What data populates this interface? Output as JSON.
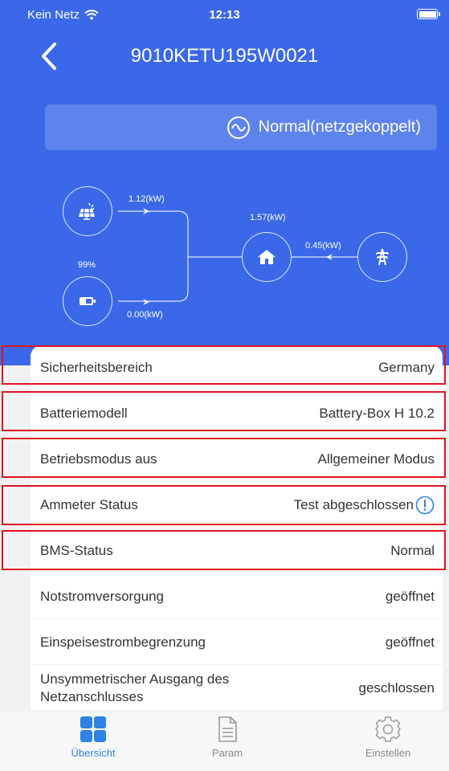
{
  "status_bar": {
    "carrier": "Kein Netz",
    "time": "12:13"
  },
  "header": {
    "title": "9010KETU195W0021",
    "mode_text": "Normal(netzgekoppelt)"
  },
  "flow": {
    "pv_power": "1.12(kW)",
    "battery_soc": "99%",
    "battery_power": "0.00(kW)",
    "home_power": "1.57(kW)",
    "grid_power": "0.45(kW)"
  },
  "rows": [
    {
      "label": "Sicherheitsbereich",
      "value": "Germany"
    },
    {
      "label": "Batteriemodell",
      "value": "Battery-Box H 10.2"
    },
    {
      "label": "Betriebsmodus aus",
      "value": "Allgemeiner Modus"
    },
    {
      "label": "Ammeter Status",
      "value": "Test abgeschlossen"
    },
    {
      "label": "BMS-Status",
      "value": "Normal"
    },
    {
      "label": "Notstromversorgung",
      "value": "geöffnet"
    },
    {
      "label": "Einspeisestrombegrenzung",
      "value": "geöffnet"
    },
    {
      "label_line1": "Unsymmetrischer Ausgang des",
      "label_line2": "Netzanschlusses",
      "value": "geschlossen"
    }
  ],
  "tabs": [
    {
      "label": "Übersicht",
      "icon": "overview-grid-icon",
      "active": true
    },
    {
      "label": "Param",
      "icon": "document-icon",
      "active": false
    },
    {
      "label": "Einstellen",
      "icon": "gear-icon",
      "active": false
    }
  ],
  "colors": {
    "header_blue": "#3a68e8",
    "highlight_red": "#e0141e",
    "active_tab": "#2d83e6",
    "info_icon": "#2d83e6"
  }
}
